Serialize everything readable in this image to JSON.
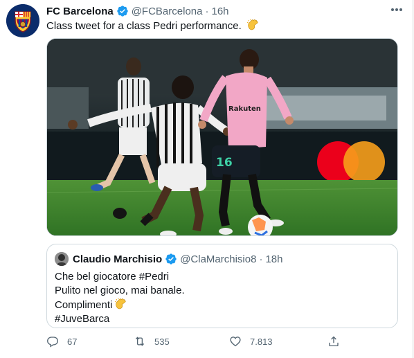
{
  "tweet": {
    "author_name": "FC Barcelona",
    "author_handle": "@FCBarcelona",
    "separator": "·",
    "time": "16h",
    "text": "Class tweet for a class Pedri performance.",
    "more_icon": "more-dots-icon"
  },
  "media": {
    "icon": "photo-football-match",
    "jersey_number": "16",
    "sponsor": "Rakuten"
  },
  "quote": {
    "author_name": "Claudio Marchisio",
    "author_handle": "@ClaMarchisio8",
    "separator": "·",
    "time": "18h",
    "lines": [
      "Che bel giocatore #Pedri",
      "Pulito nel gioco, mai banale.",
      "Complimenti",
      "#JuveBarca"
    ]
  },
  "actions": {
    "reply_count": "67",
    "retweet_count": "535",
    "like_count": "7.813"
  },
  "colors": {
    "secondary_text": "#536471",
    "verified_blue": "#1d9bf0",
    "border": "#cfd9de"
  }
}
